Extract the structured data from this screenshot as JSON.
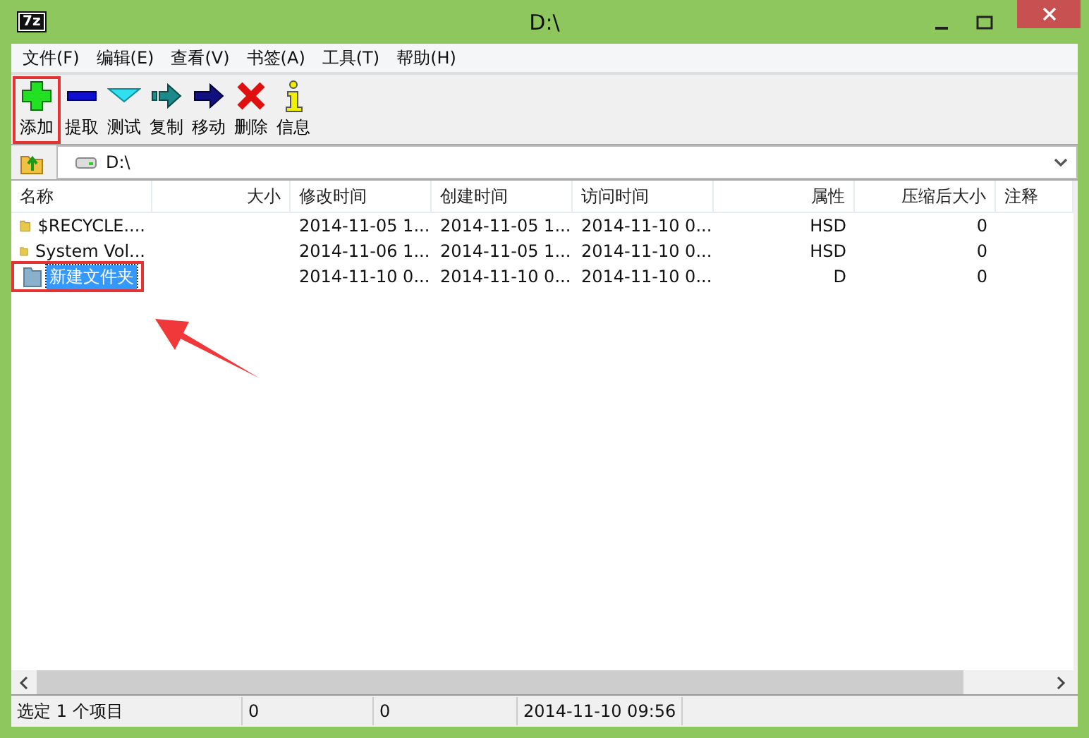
{
  "window": {
    "title": "D:\\",
    "app_logo": "7z"
  },
  "menu": [
    "文件(F)",
    "编辑(E)",
    "查看(V)",
    "书签(A)",
    "工具(T)",
    "帮助(H)"
  ],
  "toolbar": [
    {
      "label": "添加",
      "kind": "add",
      "highlighted": true
    },
    {
      "label": "提取",
      "kind": "extract",
      "highlighted": false
    },
    {
      "label": "测试",
      "kind": "test",
      "highlighted": false
    },
    {
      "label": "复制",
      "kind": "copy",
      "highlighted": false
    },
    {
      "label": "移动",
      "kind": "move",
      "highlighted": false
    },
    {
      "label": "删除",
      "kind": "delete",
      "highlighted": false
    },
    {
      "label": "信息",
      "kind": "info",
      "highlighted": false
    }
  ],
  "address": {
    "value": "D:\\"
  },
  "table": {
    "columns": [
      "名称",
      "大小",
      "修改时间",
      "创建时间",
      "访问时间",
      "属性",
      "压缩后大小",
      "注释"
    ],
    "rows": [
      {
        "cells": [
          "$RECYCLE....",
          "",
          "2014-11-05 1...",
          "2014-11-05 1...",
          "2014-11-10 0...",
          "HSD",
          "0",
          ""
        ],
        "selected": false,
        "highlighted": false,
        "kind": "folder"
      },
      {
        "cells": [
          "System Vol...",
          "",
          "2014-11-06 1...",
          "2014-11-05 1...",
          "2014-11-10 0...",
          "HSD",
          "0",
          ""
        ],
        "selected": false,
        "highlighted": false,
        "kind": "folder"
      },
      {
        "cells": [
          "新建文件夹",
          "",
          "2014-11-10 0...",
          "2014-11-10 0...",
          "2014-11-10 0...",
          "D",
          "0",
          ""
        ],
        "selected": true,
        "highlighted": true,
        "kind": "new-folder"
      }
    ]
  },
  "status_bar": [
    "选定 1 个项目",
    "0",
    "0",
    "2014-11-10 09:56"
  ]
}
